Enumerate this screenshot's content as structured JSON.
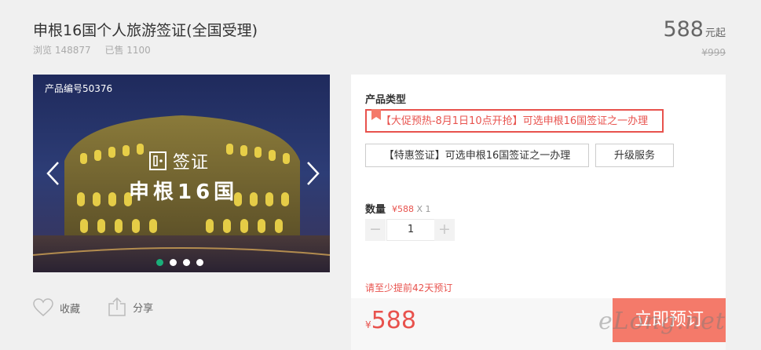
{
  "product": {
    "title": "申根16国个人旅游签证(全国受理)",
    "views": "浏览 148877",
    "sold": "已售 1100",
    "price": "588",
    "price_unit": "元起",
    "original_price": "¥999"
  },
  "slider": {
    "product_code": "产品编号50376",
    "visa_text": "签证",
    "visa_title": "申根16国",
    "dots_active_index": 0
  },
  "actions": {
    "favorite": "收藏",
    "share": "分享"
  },
  "booking": {
    "type_label": "产品类型",
    "options": [
      "【大促预热-8月1日10点开抢】可选申根16国签证之一办理",
      "【特惠签证】可选申根16国签证之一办理",
      "升级服务"
    ],
    "quantity_label": "数量",
    "unit_price": "¥588",
    "unit_multiplier": "X 1",
    "minus": "−",
    "plus": "+",
    "quantity": "1",
    "notice": "请至少提前42天预订",
    "total_currency": "¥",
    "total": "588",
    "book_button": "立即预订"
  },
  "watermark": "eLong.net",
  "colors": {
    "accent": "#e8524d",
    "button": "#f47a6a",
    "dot_active": "#1aaf7a"
  }
}
